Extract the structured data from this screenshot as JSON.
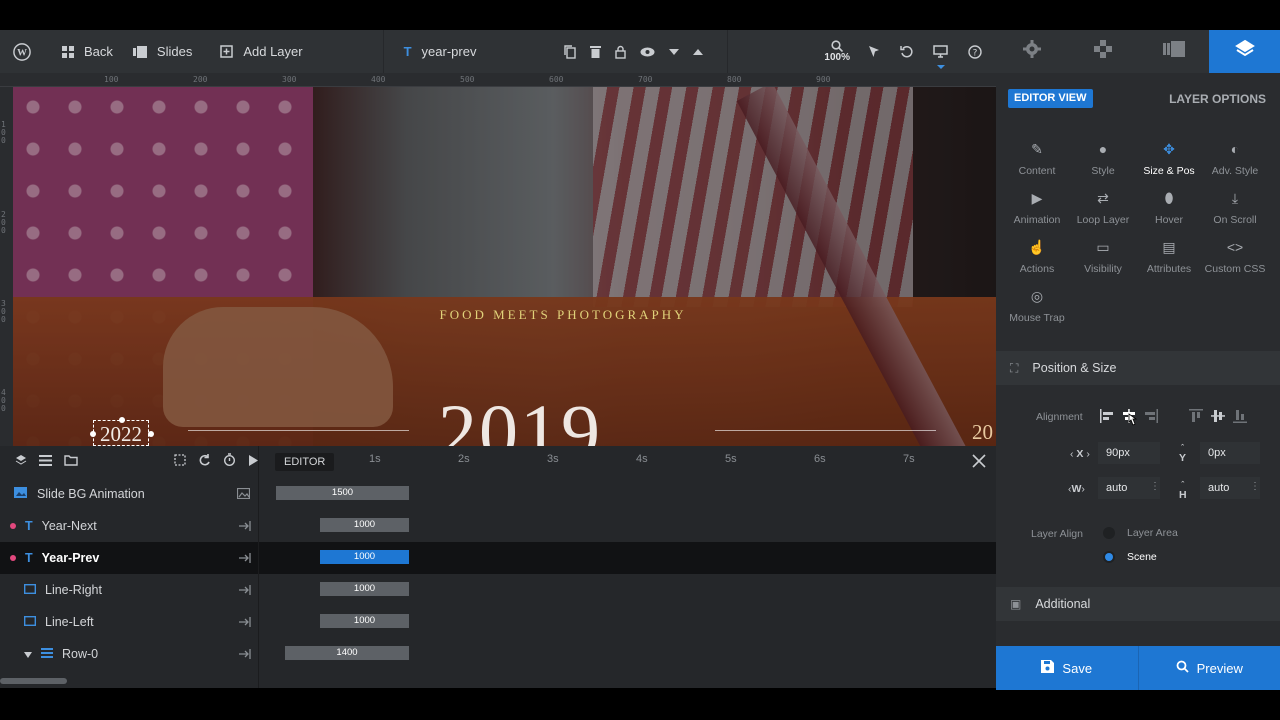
{
  "toolbar": {
    "back": "Back",
    "slides": "Slides",
    "add_layer": "Add Layer",
    "layer_name": "year-prev",
    "zoom": "100%"
  },
  "ruler": {
    "top": [
      "100",
      "200",
      "300",
      "400",
      "500",
      "600",
      "700",
      "800",
      "900"
    ],
    "left": [
      "100",
      "200",
      "300",
      "400"
    ]
  },
  "canvas": {
    "tagline": "FOOD MEETS PHOTOGRAPHY",
    "big_year": "2019",
    "year_prev": "2022",
    "year_right": "20"
  },
  "timeline": {
    "editor_label": "EDITOR",
    "time_marks": [
      "1s",
      "2s",
      "3s",
      "4s",
      "5s",
      "6s",
      "7s"
    ],
    "layers": [
      {
        "name": "Slide BG Animation",
        "duration": "1500"
      },
      {
        "name": "Year-Next",
        "duration": "1000"
      },
      {
        "name": "Year-Prev",
        "duration": "1000"
      },
      {
        "name": "Line-Right",
        "duration": "1000"
      },
      {
        "name": "Line-Left",
        "duration": "1000"
      },
      {
        "name": "Row-0",
        "duration": "1400"
      }
    ]
  },
  "panel": {
    "editor_view": "EDITOR VIEW",
    "layer_options": "LAYER OPTIONS",
    "options": [
      {
        "label": "Content",
        "icon": "pencil-icon"
      },
      {
        "label": "Style",
        "icon": "palette-icon"
      },
      {
        "label": "Size & Pos",
        "icon": "move-icon"
      },
      {
        "label": "Adv. Style",
        "icon": "contrast-icon"
      },
      {
        "label": "Animation",
        "icon": "play-icon"
      },
      {
        "label": "Loop Layer",
        "icon": "loop-icon"
      },
      {
        "label": "Hover",
        "icon": "mouse-icon"
      },
      {
        "label": "On Scroll",
        "icon": "download-icon"
      },
      {
        "label": "Actions",
        "icon": "hand-icon"
      },
      {
        "label": "Visibility",
        "icon": "monitor-icon"
      },
      {
        "label": "Attributes",
        "icon": "document-icon"
      },
      {
        "label": "Custom CSS",
        "icon": "code-icon"
      },
      {
        "label": "Mouse Trap",
        "icon": "target-icon"
      }
    ],
    "position_size": "Position & Size",
    "alignment": "Alignment",
    "x_label": "X",
    "x_value": "90px",
    "y_label": "Y",
    "y_value": "0px",
    "w_label": "W",
    "w_value": "auto",
    "h_label": "H",
    "h_value": "auto",
    "layer_align": "Layer Align",
    "layer_area": "Layer Area",
    "scene": "Scene",
    "additional": "Additional"
  },
  "buttons": {
    "save": "Save",
    "preview": "Preview"
  },
  "colors": {
    "accent": "#1e77d3",
    "pink_marker": "#e2487e",
    "tagline": "#e0d27a"
  }
}
